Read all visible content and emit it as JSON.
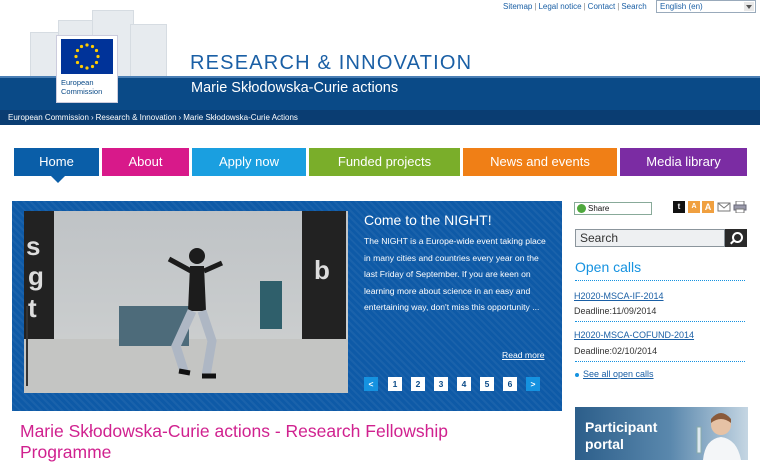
{
  "top_links": [
    "Sitemap",
    "Legal notice",
    "Contact",
    "Search"
  ],
  "language": "English (en)",
  "header": {
    "logo_line1": "European",
    "logo_line2": "Commission",
    "title": "RESEARCH & INNOVATION",
    "subtitle": "Marie Skłodowska-Curie actions"
  },
  "breadcrumb": [
    "European Commission",
    "Research & Innovation",
    "Marie Skłodowska-Curie Actions"
  ],
  "nav": [
    {
      "label": "Home",
      "color": "#0a5ea8"
    },
    {
      "label": "About",
      "color": "#d8198a"
    },
    {
      "label": "Apply now",
      "color": "#1a9fe0"
    },
    {
      "label": "Funded projects",
      "color": "#7aae2a"
    },
    {
      "label": "News and events",
      "color": "#f07f16"
    },
    {
      "label": "Media library",
      "color": "#7b2ca3"
    }
  ],
  "slider": {
    "title": "Come to the NIGHT!",
    "text": "The NIGHT is a Europe-wide event taking place in many cities and countries every year on the last Friday of September. If you are keen on learning more about science in an easy and entertaining way, don't miss this opportunity ...",
    "read_more": "Read more",
    "prev": "<",
    "next": ">",
    "pages": [
      "1",
      "2",
      "3",
      "4",
      "5",
      "6"
    ],
    "photo_letters": [
      "s",
      "g",
      "t",
      "b"
    ]
  },
  "page_title": "Marie Skłodowska-Curie actions - Research Fellowship Programme",
  "sidebar": {
    "share": "Share",
    "search_placeholder": "Search",
    "open_calls_heading": "Open calls",
    "calls": [
      {
        "id": "H2020-MSCA-IF-2014",
        "deadline": "Deadline:11/09/2014"
      },
      {
        "id": "H2020-MSCA-COFUND-2014",
        "deadline": "Deadline:02/10/2014"
      }
    ],
    "see_all": "See all open calls",
    "portal_line1": "Participant",
    "portal_line2": "portal"
  }
}
